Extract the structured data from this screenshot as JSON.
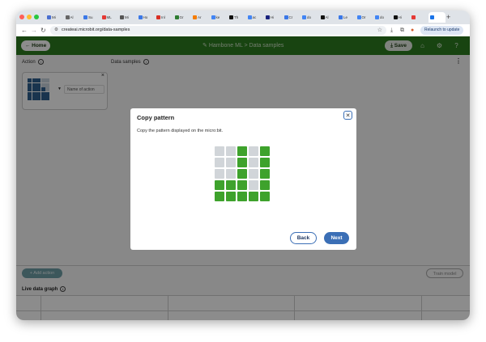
{
  "browser": {
    "tabs": [
      {
        "label": "Mi",
        "color": "#4a6fd0"
      },
      {
        "label": "Al",
        "color": "#666666"
      },
      {
        "label": "Su",
        "color": "#3b78e7"
      },
      {
        "label": "ML",
        "color": "#e53935"
      },
      {
        "label": "Mi",
        "color": "#555555"
      },
      {
        "label": "Ho",
        "color": "#3b78e7"
      },
      {
        "label": "Inl",
        "color": "#d93025"
      },
      {
        "label": "Gr",
        "color": "#2e7d32"
      },
      {
        "label": "Ar",
        "color": "#f57c00"
      },
      {
        "label": "ke",
        "color": "#4285f4"
      },
      {
        "label": "Th",
        "color": "#111111"
      },
      {
        "label": "ac",
        "color": "#4285f4"
      },
      {
        "label": "Hi",
        "color": "#1a237e"
      },
      {
        "label": "Cr",
        "color": "#3b78e7"
      },
      {
        "label": "do",
        "color": "#4285f4"
      },
      {
        "label": "Al",
        "color": "#111111"
      },
      {
        "label": "Le",
        "color": "#3b78e7"
      },
      {
        "label": "Or",
        "color": "#4285f4"
      },
      {
        "label": "do",
        "color": "#4285f4"
      },
      {
        "label": "Hi",
        "color": "#111111"
      },
      {
        "label": "",
        "color": "#e53935"
      },
      {
        "label": "",
        "color": "#1a73e8"
      }
    ],
    "url": "createai.microbit.org/data-samples",
    "relaunch_label": "Relaunch to update"
  },
  "app": {
    "home_label": "Home",
    "breadcrumb": "Hambone ML > Data samples",
    "save_label": "Save",
    "action_heading": "Action",
    "data_samples_heading": "Data samples",
    "action_name_placeholder": "Name of action",
    "add_action_label": "+ Add action",
    "train_label": "Train model",
    "live_graph_label": "Live data graph",
    "mini_pattern": [
      1,
      1,
      1,
      0,
      0,
      1,
      1,
      1,
      0,
      0,
      1,
      1,
      1,
      1,
      0,
      1,
      1,
      1,
      1,
      1,
      1,
      1,
      1,
      1,
      1
    ]
  },
  "modal": {
    "title": "Copy pattern",
    "description": "Copy the pattern displayed on the micro:bit.",
    "back_label": "Back",
    "next_label": "Next",
    "pattern": [
      0,
      0,
      1,
      0,
      1,
      0,
      0,
      1,
      0,
      1,
      0,
      0,
      1,
      0,
      1,
      1,
      1,
      1,
      0,
      1,
      1,
      1,
      1,
      1,
      1
    ]
  },
  "colors": {
    "header_green": "#2d7d1f",
    "pattern_on": "#3ea22c",
    "pattern_off": "#d1d5d9",
    "mini_on": "#2f5f8f",
    "mini_off": "#c9d3de",
    "primary_blue": "#3b6fb6"
  }
}
